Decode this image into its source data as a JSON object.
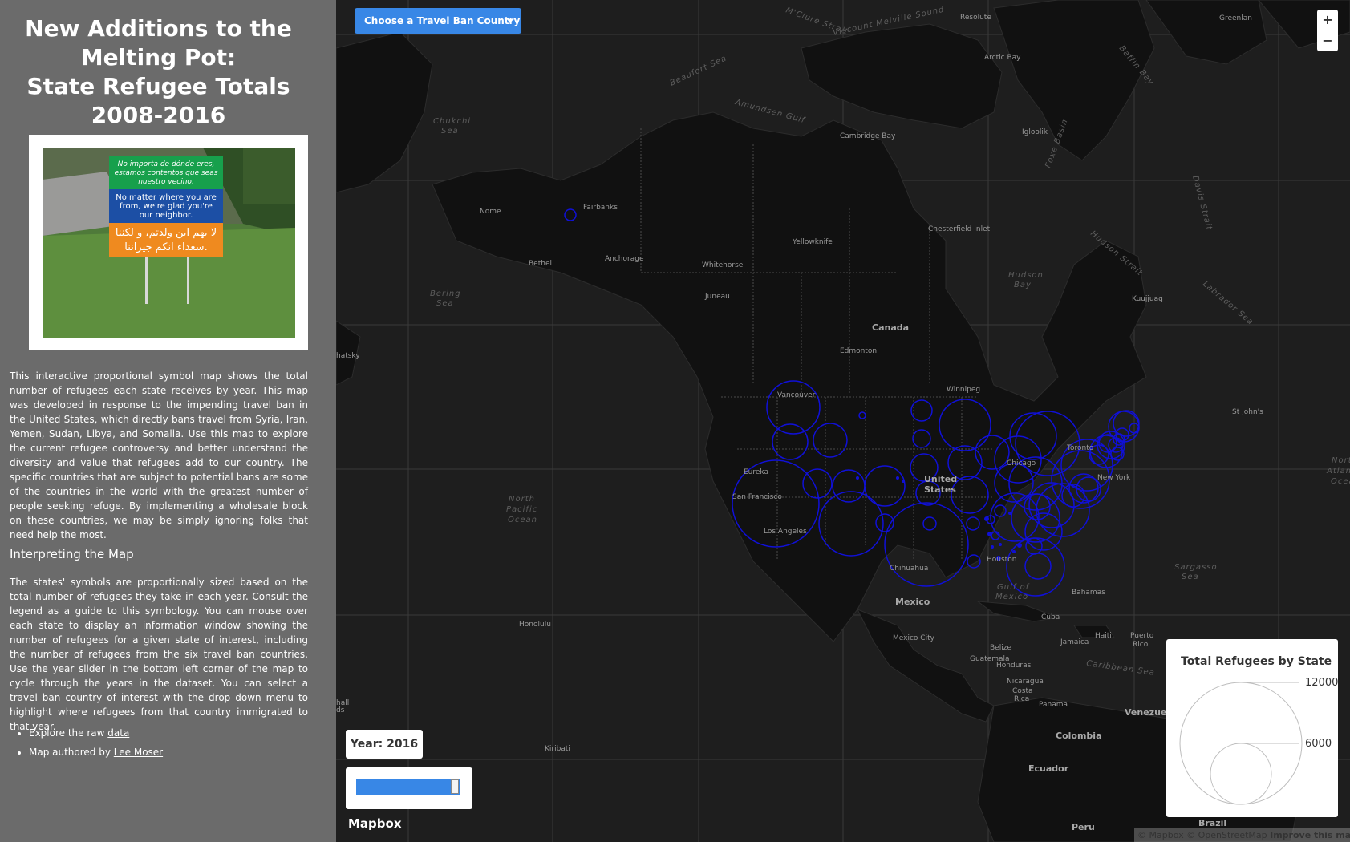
{
  "sidebar": {
    "title_lines": [
      "New Additions to the",
      "Melting Pot:",
      "State Refugee Totals",
      "2008-2016"
    ],
    "sign": {
      "line1": "No importa de dónde eres,",
      "line2": "estamos contentos que seas",
      "line3": "nuestro vecino.",
      "line4": "No matter where you are",
      "line5": "from, we're glad you're",
      "line6": "our neighbor.",
      "line7": "لا يهم اين ولدتم، و لكننا",
      "line8": "سعداء انكم جيراننا."
    },
    "intro": "This interactive proportional symbol map shows the total number of refugees each state receives by year. This map was developed in response to the impending travel ban in the United States, which directly bans travel from Syria, Iran, Yemen, Sudan, Libya, and Somalia. Use this map to explore the current refugee controversy and better understand the diversity and value that refugees add to our country. The specific countries that are subject to potential bans are some of the countries in the world with the greatest number of people seeking refuge. By implementing a wholesale block on these countries, we may be simply ignoring folks that need help the most.",
    "interp_heading": "Interpreting the Map",
    "interp_text": "The states' symbols are proportionally sized based on the total number of refugees they take in each year. Consult the legend as a guide to this symbology. You can mouse over each state to display an information window showing the number of refugees for a given state of interest, including the number of refugees from the six travel ban countries. Use the year slider in the bottom left corner of the map to cycle through the years in the dataset. You can select a travel ban country of interest with the drop down menu to highlight where refugees from that country immigrated to that year.",
    "link1_prefix": "Explore the raw ",
    "link1_text": "data",
    "link2_prefix": "Map authored by ",
    "link2_text": "Lee Moser"
  },
  "map": {
    "dropdown_label": "Choose a Travel Ban Country",
    "zoom_in": "+",
    "zoom_out": "−",
    "year_label": "Year: 2016",
    "year_slider_value": 2016,
    "mapbox_logo": "Mapbox",
    "attribution_1": "© Mapbox",
    "attribution_2": "© OpenStreetMap",
    "attribution_3": "Improve this map",
    "symbol_color": "#1010d8",
    "accent_color": "#3887e6",
    "labels": {
      "greenland": "Greenlan",
      "resolute": "Resolute",
      "arctic_bay": "Arctic Bay",
      "baffin_bay": "Baffin Bay",
      "mcclure": "M'Clure Strait",
      "melville": "Viscount Melville Sound",
      "beaufort": "Beaufort Sea",
      "amundsen": "Amundsen Gulf",
      "chukchi1": "Chukchi",
      "chukchi2": "Sea",
      "cambridge": "Cambridge Bay",
      "igloolik": "Igloolik",
      "foxe": "Foxe Basin",
      "davis": "Davis Strait",
      "nome": "Nome",
      "fairbanks": "Fairbanks",
      "chesterfield": "Chesterfield Inlet",
      "yellowknife": "Yellowknife",
      "hudson_strait": "Hudson Strait",
      "bethel": "Bethel",
      "anchorage": "Anchorage",
      "whitehorse": "Whitehorse",
      "hudson1": "Hudson",
      "hudson2": "Bay",
      "bering1": "Bering",
      "bering2": "Sea",
      "juneau": "Juneau",
      "kuujjuaq": "Kuujjuaq",
      "labrador": "Labrador Sea",
      "canada": "Canada",
      "edmonton": "Edmonton",
      "chatsky": "hatsky",
      "winnipeg": "Winnipeg",
      "vancouver": "Vancouver",
      "stjohns": "St John's",
      "toronto": "Toronto",
      "chicago": "Chicago",
      "eureka": "Eureka",
      "united1": "United",
      "united2": "States",
      "newyork": "New York",
      "natl1": "North",
      "natl2": "Atlant",
      "natl3": "Ocean",
      "sf": "San Francisco",
      "npac1": "North",
      "npac2": "Pacific",
      "npac3": "Ocean",
      "la": "Los Angeles",
      "houston": "Houston",
      "chihuahua": "Chihuahua",
      "sargasso1": "Sargasso",
      "sargasso2": "Sea",
      "gulf1": "Gulf of",
      "gulf2": "Mexico",
      "bahamas": "Bahamas",
      "mexico": "Mexico",
      "honolulu": "Honolulu",
      "cuba": "Cuba",
      "mexico_city": "Mexico City",
      "belize": "Belize",
      "jamaica": "Jamaica",
      "haiti": "Haiti",
      "puerto1": "Puerto",
      "puerto2": "Rico",
      "guatemala": "Guatemala",
      "honduras": "Honduras",
      "caribbean": "Caribbean Sea",
      "hall1": "hall",
      "hall2": "ds",
      "nicaragua": "Nicaragua",
      "costa1": "Costa",
      "costa2": "Rica",
      "panama": "Panama",
      "venezuela": "Venezuela",
      "colombia": "Colombia",
      "kiribati": "Kiribati",
      "ecuador": "Ecuador",
      "peru": "Peru",
      "brazil": "Brazil"
    }
  },
  "legend": {
    "title": "Total Refugees by State",
    "max_label": "12000",
    "mid_label": "6000"
  }
}
